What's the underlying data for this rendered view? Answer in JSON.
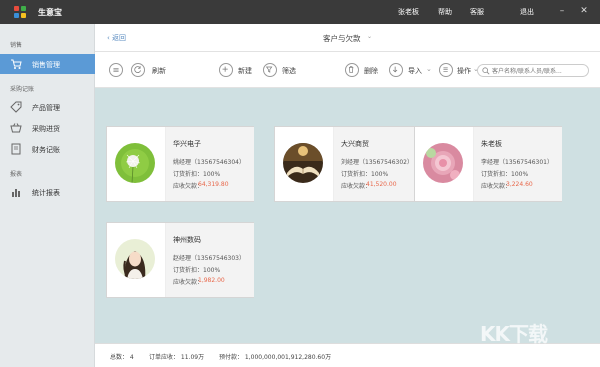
{
  "app": {
    "title": "生意宝",
    "user": "张老板",
    "help": "帮助",
    "service": "客服",
    "logout": "退出"
  },
  "sidebar": {
    "sections": [
      {
        "label": "销售"
      },
      {
        "label": "采购记账"
      },
      {
        "label": "报表"
      }
    ],
    "items": [
      {
        "label": "销售管理",
        "icon": "cart-icon",
        "active": true
      },
      {
        "label": "产品管理",
        "icon": "tag-icon"
      },
      {
        "label": "采购进货",
        "icon": "basket-icon"
      },
      {
        "label": "财务记账",
        "icon": "ledger-icon"
      },
      {
        "label": "统计报表",
        "icon": "bar-chart-icon"
      }
    ]
  },
  "header": {
    "back_label": "返回",
    "title": "客户与欠款"
  },
  "toolbar": {
    "refresh": "刷新",
    "new": "新建",
    "filter": "筛选",
    "delete": "删除",
    "import": "导入",
    "operation": "操作",
    "search_placeholder": "客户名称/联系人员/联系..."
  },
  "customers": [
    {
      "name": "华兴电子",
      "contact": "姚经理（13567546304）",
      "discount_label": "订货折扣：",
      "discount": "100%",
      "owe_label": "应收欠款：",
      "owe": "64,319.80",
      "photo": "dandelion"
    },
    {
      "name": "大兴商贸",
      "contact": "刘经理（13567546302）",
      "discount_label": "订货折扣：",
      "discount": "100%",
      "owe_label": "应收欠款：",
      "owe": "41,520.00",
      "photo": "book"
    },
    {
      "name": "朱老板",
      "contact": "李经理（13567546301）",
      "discount_label": "订货折扣：",
      "discount": "100%",
      "owe_label": "应收欠款：",
      "owe": "3,224.60",
      "photo": "rose"
    },
    {
      "name": "神州数码",
      "contact": "赵经理（13567546303）",
      "discount_label": "订货折扣：",
      "discount": "100%",
      "owe_label": "应收欠款：",
      "owe": "1,982.00",
      "photo": "girl"
    }
  ],
  "status": {
    "total": "总数：  4",
    "order_receivable": "订单应收：  11.09万",
    "prepaid": "预付款：  1,000,000,001,912,280.60万"
  },
  "watermark": {
    "logo": "KK下载",
    "url": "www.kkx.net"
  },
  "colors": {
    "accent": "#5b9ad6",
    "owe": "#e8674a",
    "content_bg": "#cfe0e2"
  }
}
